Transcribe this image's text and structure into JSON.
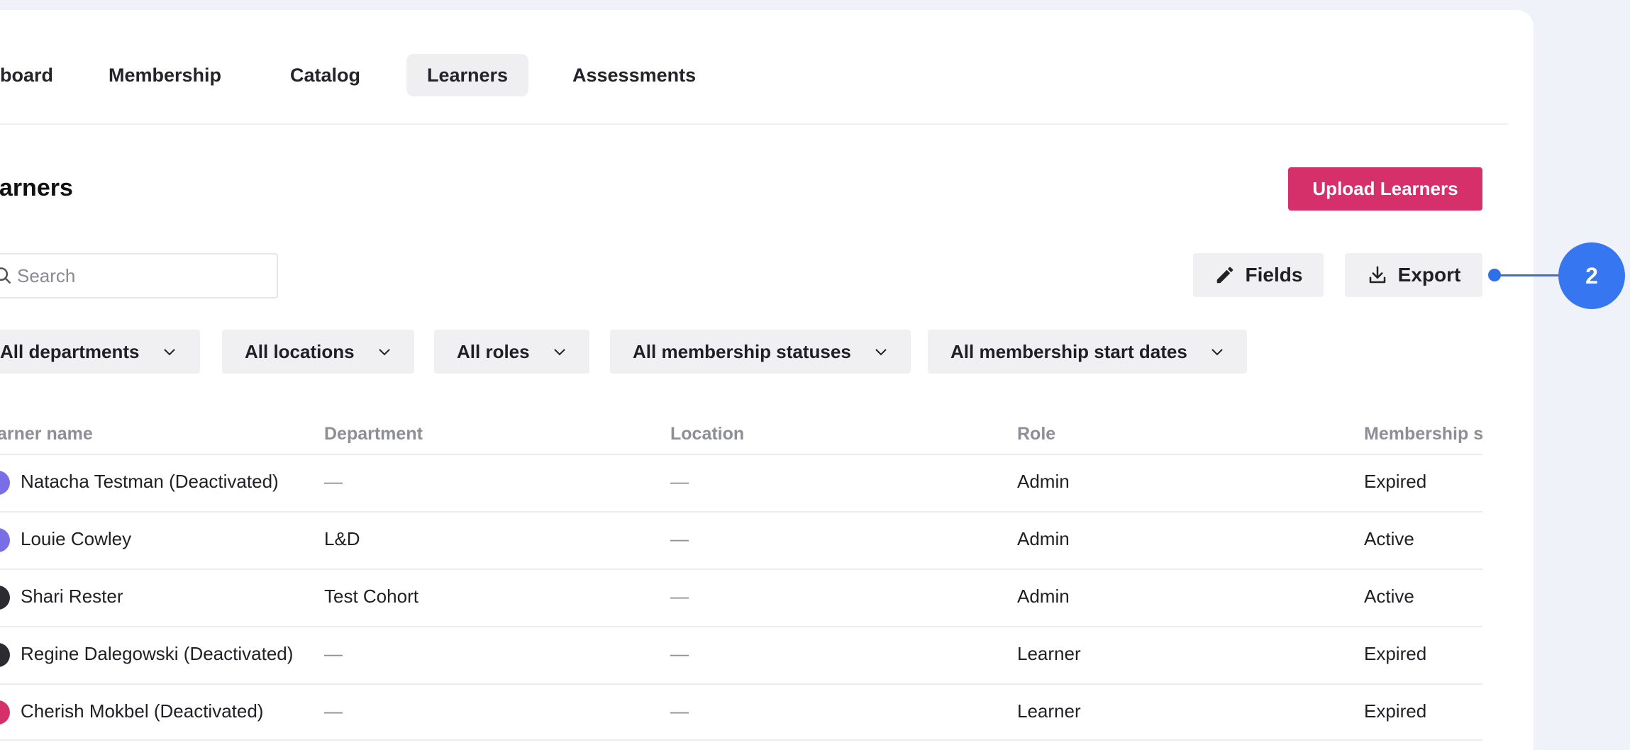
{
  "nav": {
    "tabs": [
      {
        "label": "board",
        "active": false
      },
      {
        "label": "Membership",
        "active": false
      },
      {
        "label": "Catalog",
        "active": false
      },
      {
        "label": "Learners",
        "active": true
      },
      {
        "label": "Assessments",
        "active": false
      }
    ]
  },
  "header": {
    "title": "earners",
    "upload_label": "Upload Learners"
  },
  "search": {
    "placeholder": "Search",
    "value": ""
  },
  "actions": {
    "fields_label": "Fields",
    "export_label": "Export"
  },
  "filters": [
    "All departments",
    "All locations",
    "All roles",
    "All membership statuses",
    "All membership start dates"
  ],
  "table": {
    "columns": [
      "arner name",
      "Department",
      "Location",
      "Role",
      "Membership s"
    ],
    "rows": [
      {
        "name": "Natacha Testman (Deactivated)",
        "department": "—",
        "location": "—",
        "role": "Admin",
        "status": "Expired",
        "avatar_color": "#7a6ee6"
      },
      {
        "name": "Louie Cowley",
        "department": "L&D",
        "location": "—",
        "role": "Admin",
        "status": "Active",
        "avatar_color": "#7a6ee6"
      },
      {
        "name": "Shari Rester",
        "department": "Test Cohort",
        "location": "—",
        "role": "Admin",
        "status": "Active",
        "avatar_color": "#2b2b31"
      },
      {
        "name": "Regine Dalegowski (Deactivated)",
        "department": "—",
        "location": "—",
        "role": "Learner",
        "status": "Expired",
        "avatar_color": "#2b2b31"
      },
      {
        "name": "Cherish Mokbel (Deactivated)",
        "department": "—",
        "location": "—",
        "role": "Learner",
        "status": "Expired",
        "avatar_color": "#d6306b"
      }
    ]
  },
  "annotation": {
    "badge": "2",
    "color": "#3677f1"
  },
  "colors": {
    "accent": "#d6306b",
    "background": "#eff2f8"
  }
}
